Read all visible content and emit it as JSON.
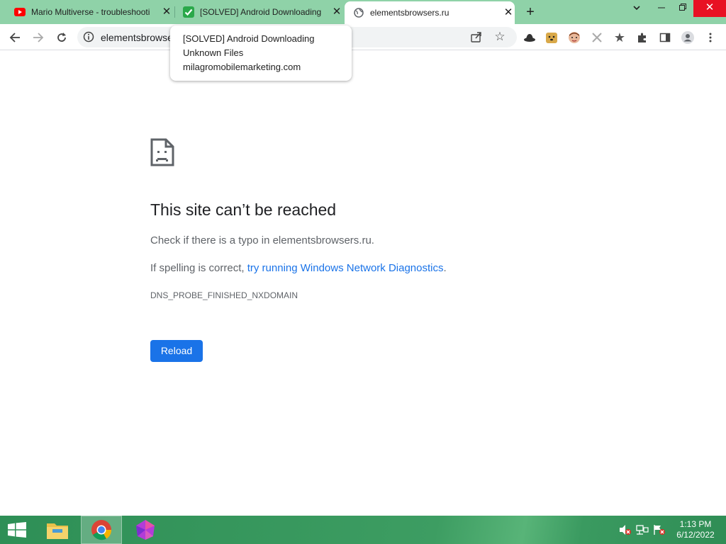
{
  "browser": {
    "tabs": [
      {
        "title": "Mario Multiverse - troubleshooti",
        "favicon": "youtube-icon",
        "active": false
      },
      {
        "title": "[SOLVED] Android Downloading",
        "favicon": "green-check-icon",
        "active": false
      },
      {
        "title": "elementsbrowsers.ru",
        "favicon": "globe-icon",
        "active": true
      }
    ],
    "new_tab": "+",
    "address": "elementsbrowse",
    "tooltip": {
      "title": "[SOLVED] Android Downloading Unknown Files",
      "url": "milagromobilemarketing.com"
    }
  },
  "error_page": {
    "heading": "This site can’t be reached",
    "line1": "Check if there is a typo in elementsbrowsers.ru.",
    "line2_prefix": "If spelling is correct, ",
    "line2_link": "try running Windows Network Diagnostics",
    "line2_suffix": ".",
    "error_code": "DNS_PROBE_FINISHED_NXDOMAIN",
    "reload_label": "Reload"
  },
  "taskbar": {
    "time": "1:13 PM",
    "date": "6/12/2022",
    "apps": [
      "file-explorer-icon",
      "chrome-icon",
      "tor-browser-icon"
    ]
  },
  "colors": {
    "tabstrip": "#8fd2a8",
    "link": "#1a73e8",
    "button": "#1a73e8",
    "taskbar": "#2e8f56"
  }
}
